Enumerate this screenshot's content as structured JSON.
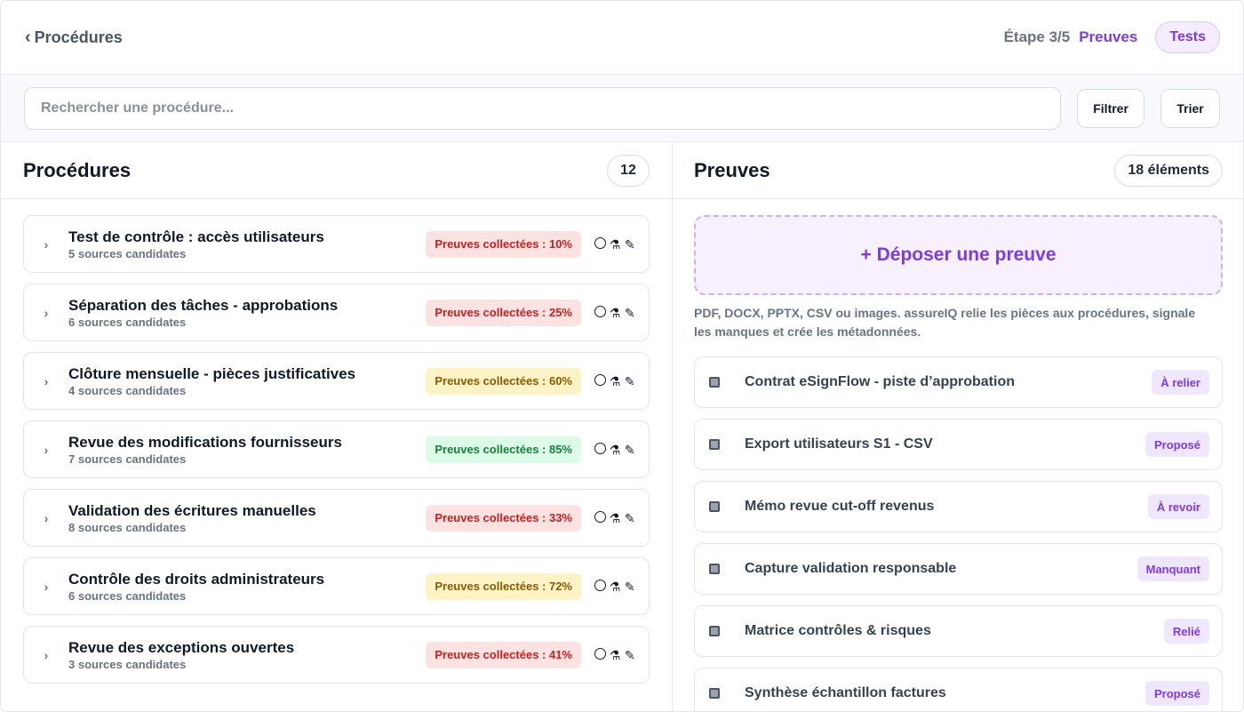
{
  "header": {
    "back_label": "Procédures",
    "step_label": "Étape 3/5",
    "step_current": "Preuves",
    "step_next": "Tests"
  },
  "search": {
    "placeholder": "Rechercher une procédure...",
    "filter_label": "Filtrer",
    "sort_label": "Trier"
  },
  "procedures": {
    "title": "Procédures",
    "count": "12",
    "items": [
      {
        "title": "Test de contrôle : accès utilisateurs",
        "subtitle": "5 sources candidates",
        "badge": "Preuves collectées : 10%",
        "level": "red"
      },
      {
        "title": "Séparation des tâches - approbations",
        "subtitle": "6 sources candidates",
        "badge": "Preuves collectées : 25%",
        "level": "red"
      },
      {
        "title": "Clôture mensuelle - pièces justificatives",
        "subtitle": "4 sources candidates",
        "badge": "Preuves collectées : 60%",
        "level": "yellow"
      },
      {
        "title": "Revue des modifications fournisseurs",
        "subtitle": "7 sources candidates",
        "badge": "Preuves collectées : 85%",
        "level": "green"
      },
      {
        "title": "Validation des écritures manuelles",
        "subtitle": "8 sources candidates",
        "badge": "Preuves collectées : 33%",
        "level": "red"
      },
      {
        "title": "Contrôle des droits administrateurs",
        "subtitle": "6 sources candidates",
        "badge": "Preuves collectées : 72%",
        "level": "yellow"
      },
      {
        "title": "Revue des exceptions ouvertes",
        "subtitle": "3 sources candidates",
        "badge": "Preuves collectées : 41%",
        "level": "red"
      }
    ],
    "action_icons": [
      "circle-icon",
      "flask-icon",
      "pencil-icon"
    ]
  },
  "evidence": {
    "title": "Preuves",
    "count": "18 éléments",
    "drop_label": "+ Déposer une preuve",
    "drop_hint": "PDF, DOCX, PPTX, CSV ou images. assureIQ relie les pièces aux procédures, signale les manques et crée les métadonnées.",
    "items": [
      {
        "title": "Contrat eSignFlow - piste d’approbation",
        "status": "À relier"
      },
      {
        "title": "Export utilisateurs S1 - CSV",
        "status": "Proposé"
      },
      {
        "title": "Mémo revue cut-off revenus",
        "status": "À revoir"
      },
      {
        "title": "Capture validation responsable",
        "status": "Manquant"
      },
      {
        "title": "Matrice contrôles & risques",
        "status": "Relié"
      },
      {
        "title": "Synthèse échantillon factures",
        "status": "Proposé"
      }
    ]
  },
  "colors": {
    "accent": "#7c3aed",
    "badge_red": "#c81e1e",
    "badge_yellow": "#8a5a00",
    "badge_green": "#15803d"
  }
}
